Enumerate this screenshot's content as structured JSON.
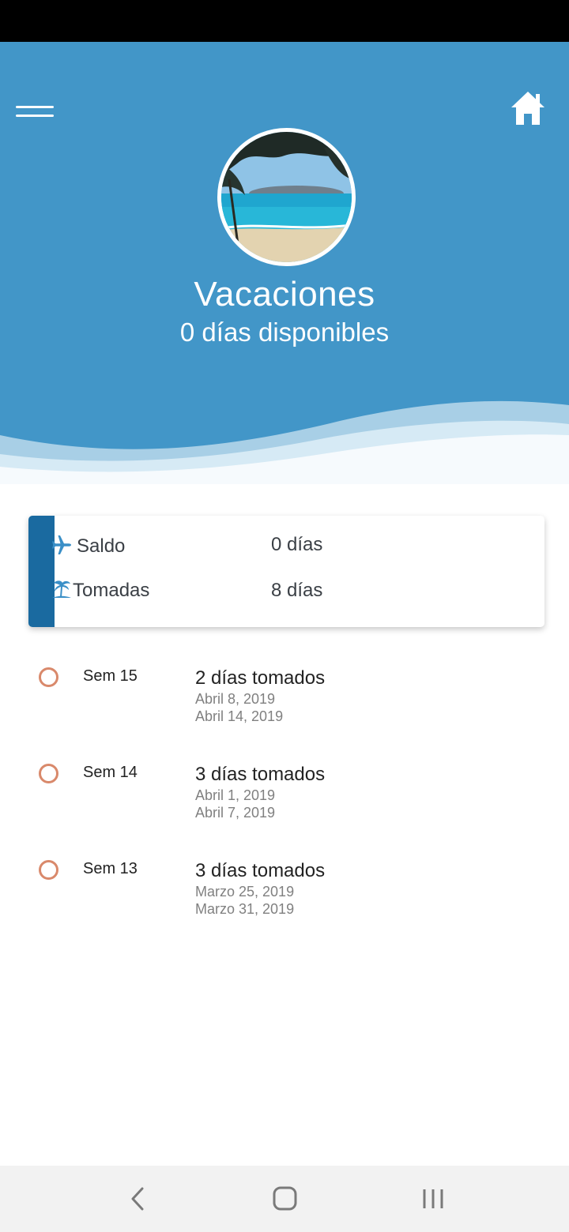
{
  "header": {
    "title": "Vacaciones",
    "subtitle": "0 días disponibles",
    "background_color": "#4296c8",
    "menu_icon": "hamburger-icon",
    "home_icon": "home-icon",
    "avatar": "beach-photo"
  },
  "summary": {
    "accent_color": "#1a6aa0",
    "rows": [
      {
        "icon": "airplane-icon",
        "label": "Saldo",
        "value": "0 días"
      },
      {
        "icon": "palm-tree-icon",
        "label": "Tomadas",
        "value": "8 días"
      }
    ]
  },
  "timeline": {
    "dot_color": "#d9896b",
    "items": [
      {
        "week": "Sem 15",
        "days": "2 días tomados",
        "start": "Abril 8, 2019",
        "end": "Abril 14, 2019"
      },
      {
        "week": "Sem 14",
        "days": "3 días tomados",
        "start": "Abril 1, 2019",
        "end": "Abril 7, 2019"
      },
      {
        "week": "Sem 13",
        "days": "3 días tomados",
        "start": "Marzo 25, 2019",
        "end": "Marzo 31, 2019"
      }
    ]
  },
  "navigation": {
    "back_icon": "back-chevron-icon",
    "home_icon": "home-circle-icon",
    "recents_icon": "recents-icon"
  }
}
